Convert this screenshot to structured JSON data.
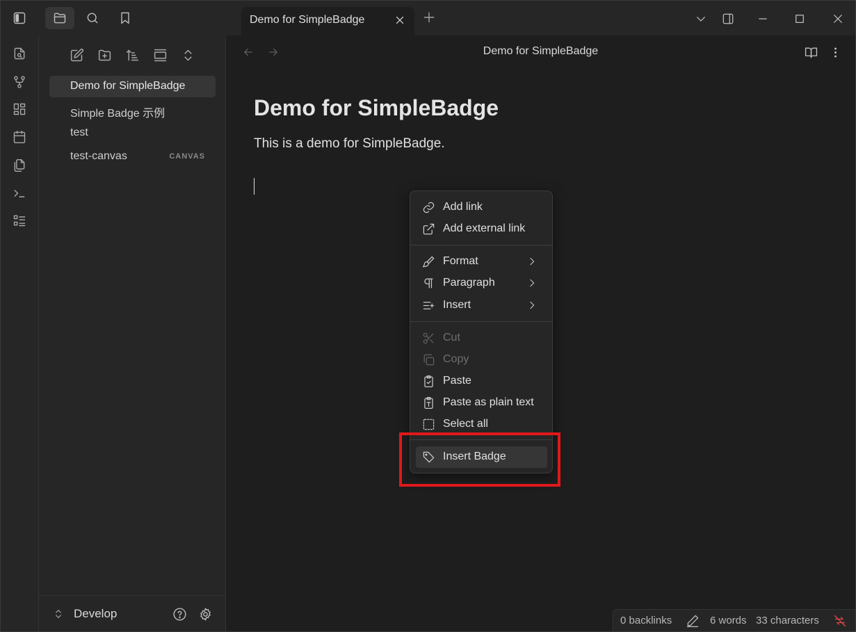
{
  "tab": {
    "label": "Demo for SimpleBadge"
  },
  "sidebar": {
    "files": [
      {
        "name": "Demo for SimpleBadge",
        "badge": ""
      },
      {
        "name": "Simple Badge 示例",
        "badge": ""
      },
      {
        "name": "test",
        "badge": ""
      },
      {
        "name": "test-canvas",
        "badge": "CANVAS"
      }
    ],
    "vault_name": "Develop"
  },
  "view": {
    "title": "Demo for SimpleBadge"
  },
  "document": {
    "heading": "Demo for SimpleBadge",
    "paragraph": "This is a demo for SimpleBadge."
  },
  "context_menu": {
    "items": [
      {
        "label": "Add link",
        "icon": "link-icon"
      },
      {
        "label": "Add external link",
        "icon": "external-link-icon"
      },
      {
        "label": "Format",
        "icon": "paintbrush-icon"
      },
      {
        "label": "Paragraph",
        "icon": "pilcrow-icon"
      },
      {
        "label": "Insert",
        "icon": "list-plus-icon"
      },
      {
        "label": "Cut",
        "icon": "scissors-icon"
      },
      {
        "label": "Copy",
        "icon": "copy-icon"
      },
      {
        "label": "Paste",
        "icon": "clipboard-check-icon"
      },
      {
        "label": "Paste as plain text",
        "icon": "clipboard-type-icon"
      },
      {
        "label": "Select all",
        "icon": "select-all-icon"
      },
      {
        "label": "Insert Badge",
        "icon": "tag-icon"
      }
    ]
  },
  "statusbar": {
    "backlinks": "0 backlinks",
    "words": "6 words",
    "characters": "33 characters"
  },
  "colors": {
    "highlight": "#e0181b",
    "sync_error": "#e0464b"
  }
}
